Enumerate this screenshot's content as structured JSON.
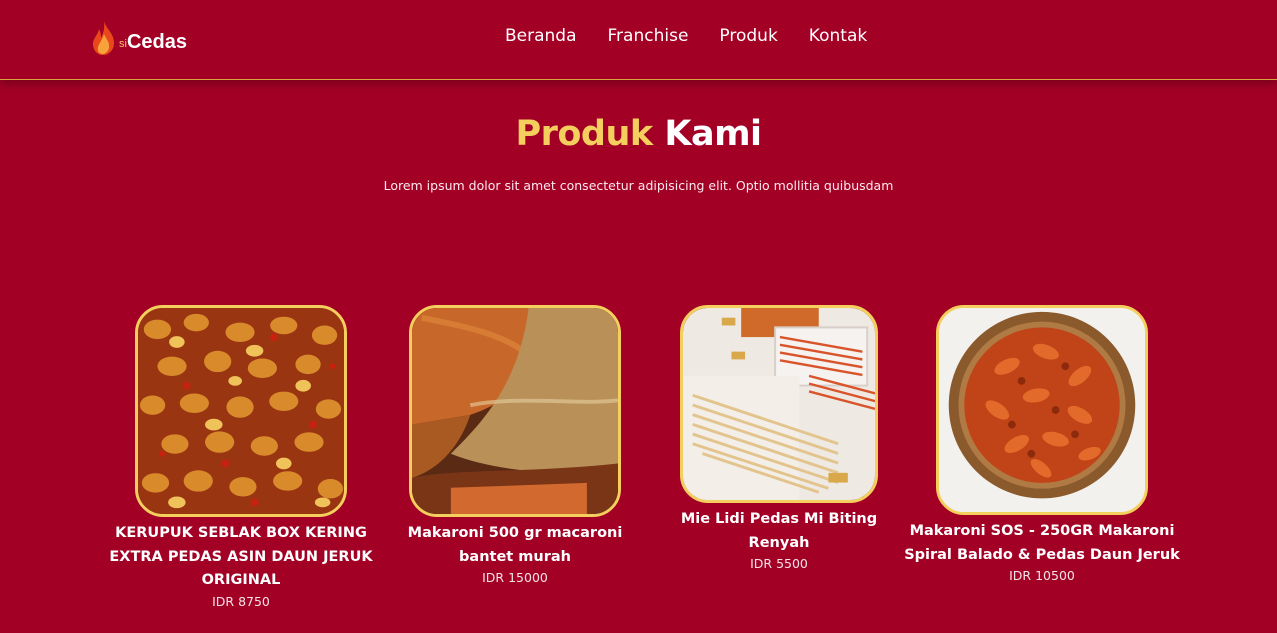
{
  "brand": {
    "prefix": "si",
    "name": "Cedas"
  },
  "nav": {
    "items": [
      "Beranda",
      "Franchise",
      "Produk",
      "Kontak"
    ]
  },
  "section": {
    "title_accent": "Produk",
    "title_rest": "Kami",
    "subtitle": "Lorem ipsum dolor sit amet consectetur adipisicing elit. Optio mollitia quibusdam"
  },
  "products": [
    {
      "name": "KERUPUK SEBLAK BOX KERING EXTRA PEDAS ASIN DAUN JERUK ORIGINAL",
      "price": "IDR 8750",
      "image": "kerupuk-seblak-photo"
    },
    {
      "name": "Makaroni 500 gr macaroni bantet murah",
      "price": "IDR 15000",
      "image": "makaroni-bags-photo"
    },
    {
      "name": "Mie Lidi Pedas Mi Biting Renyah",
      "price": "IDR 5500",
      "image": "mie-lidi-photo"
    },
    {
      "name": "Makaroni SOS - 250GR Makaroni Spiral Balado & Pedas Daun Jeruk",
      "price": "IDR 10500",
      "image": "makaroni-spiral-photo"
    }
  ],
  "colors": {
    "background": "#a30026",
    "accent": "#f4cf5e",
    "text": "#ffffff"
  }
}
